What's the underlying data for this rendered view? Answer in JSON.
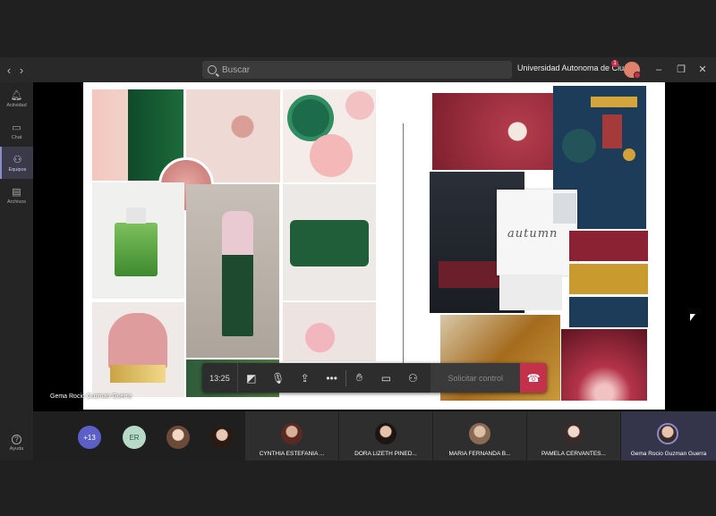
{
  "titlebar": {
    "search_placeholder": "Buscar",
    "org_name": "Universidad Autonoma de Ciu...",
    "org_badge": "1"
  },
  "rail": {
    "items": [
      {
        "label": "Actividad",
        "icon": "bell-icon"
      },
      {
        "label": "Chat",
        "icon": "chat-icon"
      },
      {
        "label": "Equipos",
        "icon": "teams-icon"
      },
      {
        "label": "Archivos",
        "icon": "files-icon"
      }
    ],
    "help_label": "Ayuda"
  },
  "share": {
    "presenter_name": "Gema Rocio Guzman Guerra",
    "moodboard_text": "autumn"
  },
  "toolbar": {
    "time": "13:25",
    "request_control": "Solicitar control"
  },
  "participants": {
    "overflow_count": "+13",
    "initials": "ER",
    "tiles": [
      {
        "name": "CYNTHIA ESTEFANIA ..."
      },
      {
        "name": "DORA LIZETH PINED..."
      },
      {
        "name": "MARIA FERNANDA B..."
      },
      {
        "name": "PAMELA CERVANTES..."
      },
      {
        "name": "Gema Rocio Guzman Guerra"
      }
    ]
  },
  "colors": {
    "accent": "#8b8cc7",
    "hangup": "#c4314b"
  }
}
